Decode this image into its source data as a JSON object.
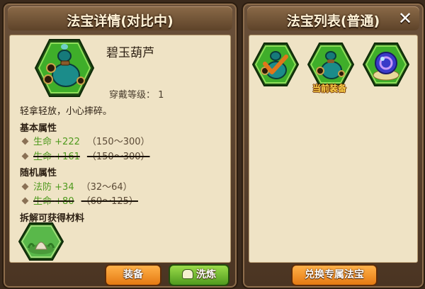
{
  "left_panel": {
    "title": "法宝详情(对比中)",
    "item_name": "碧玉葫芦",
    "equip_level_label": "穿戴等级：",
    "equip_level_value": "1",
    "description": "轻拿轻放，小心摔碎。",
    "base_title": "基本属性",
    "base_attrs": [
      {
        "name": "生命",
        "value": "+222",
        "range": "（150～300）"
      },
      {
        "name": "生命",
        "value": "+161",
        "range": "（150～300）"
      }
    ],
    "random_title": "随机属性",
    "random_attrs": [
      {
        "name": "法防",
        "value": "+34",
        "range": "（32～64）"
      },
      {
        "name": "生命",
        "value": "+80",
        "range": "（60～125）"
      }
    ],
    "dismantle_title": "拆解可获得材料",
    "equip_button": "装备",
    "refine_button": "洗炼"
  },
  "right_panel": {
    "title": "法宝列表(普通)",
    "close_symbol": "✕",
    "current_equipped_label": "当前装备",
    "exchange_button": "兑换专属法宝"
  }
}
